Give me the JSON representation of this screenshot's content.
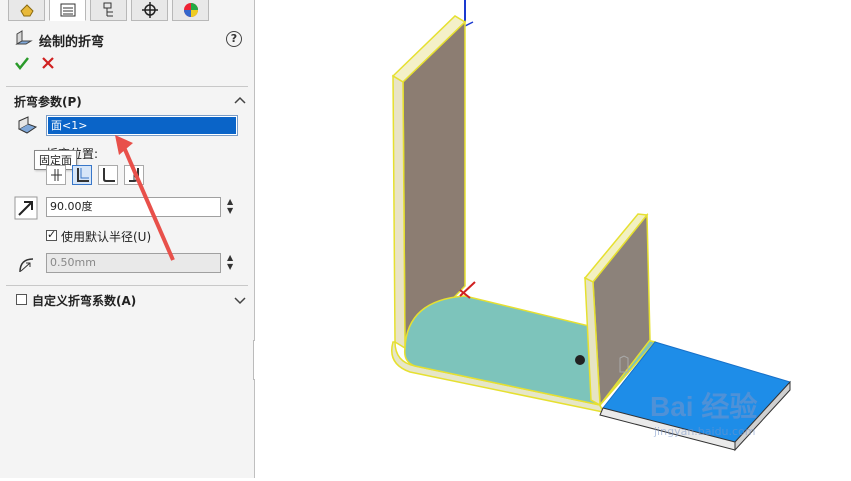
{
  "tabs": [
    {
      "name": "featuremanager-tab",
      "icon": "feature-manager-icon"
    },
    {
      "name": "propertymanager-tab",
      "icon": "property-manager-icon"
    },
    {
      "name": "configuration-tab",
      "icon": "configuration-icon"
    },
    {
      "name": "dimxpert-tab",
      "icon": "crosshair-icon"
    },
    {
      "name": "display-tab",
      "icon": "appearance-icon"
    }
  ],
  "panel": {
    "title": "绘制的折弯",
    "help": "?"
  },
  "bend_params": {
    "heading": "折弯参数(P)",
    "face_value": "面<1>",
    "tooltip": "固定面",
    "position_label": "折弯位置:",
    "angle_value": "90.00度",
    "use_default_radius_label": "使用默认半径(U)",
    "use_default_radius_checked": true,
    "radius_value": "0.50mm"
  },
  "custom_bend": {
    "label": "自定义折弯系数(A)",
    "checked": false
  },
  "watermark": {
    "brand": "Bai 经验",
    "url": "jingyan.baidu.com"
  }
}
